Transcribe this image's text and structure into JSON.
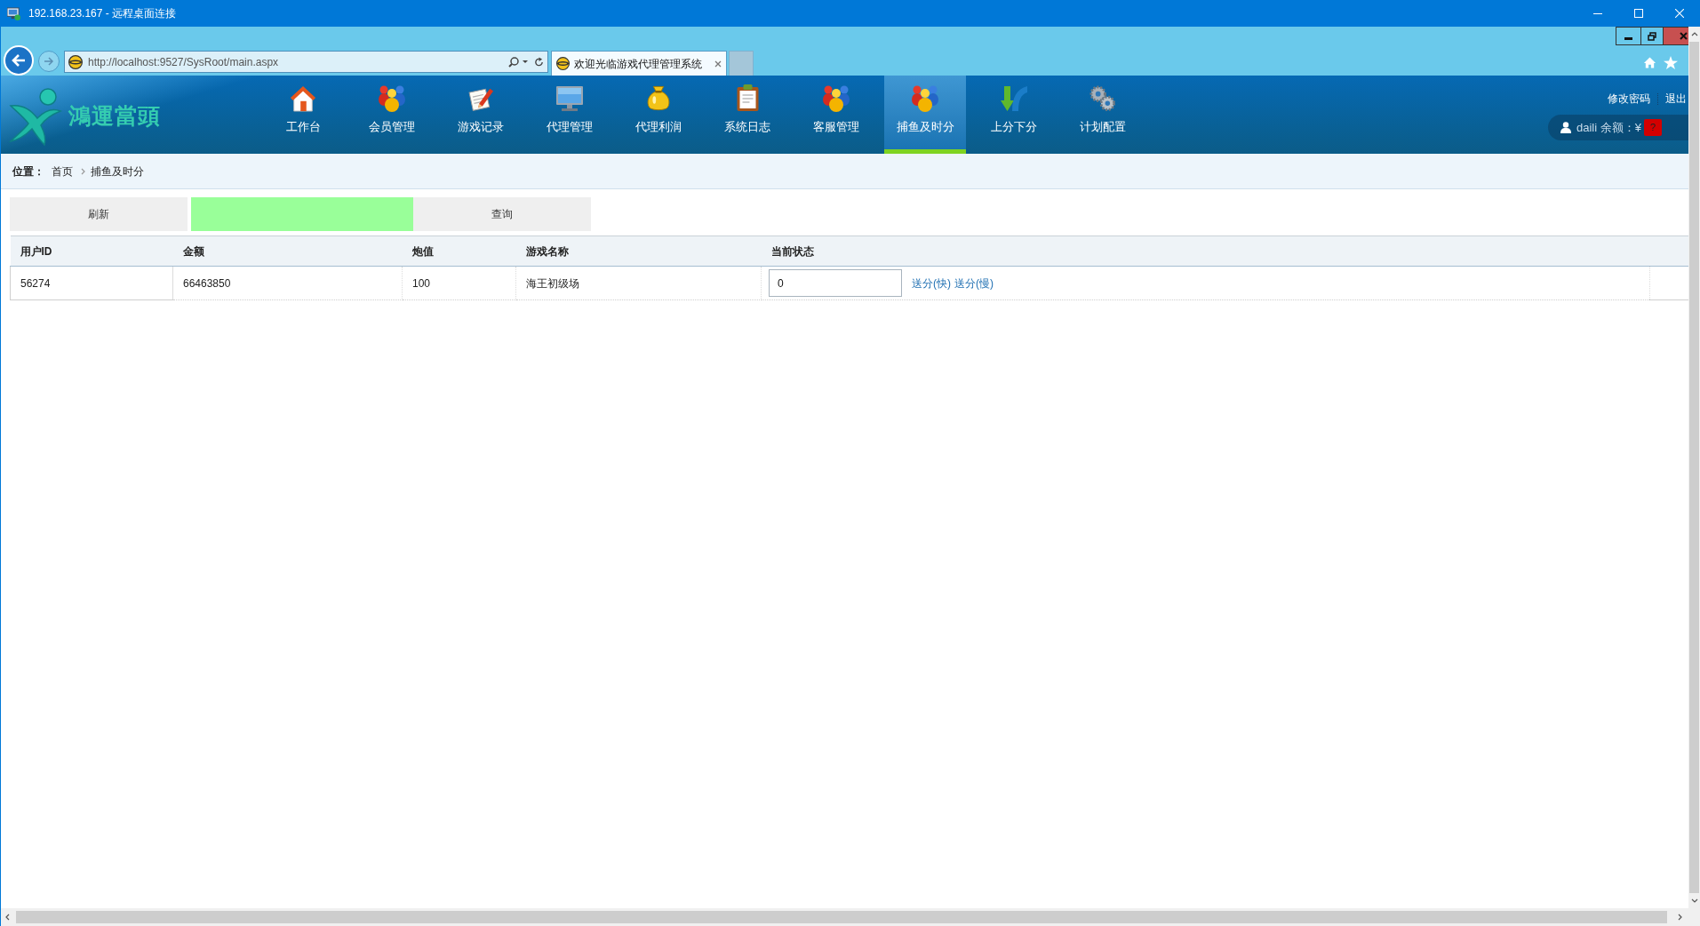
{
  "remote_window": {
    "title": "192.168.23.167 - 远程桌面连接"
  },
  "browser": {
    "address": "http://localhost:9527/SysRoot/main.aspx",
    "tabs": [
      {
        "title": "欢迎光临游戏代理管理系统",
        "selected": true
      }
    ]
  },
  "header": {
    "logo_text": "鴻運當頭",
    "nav": [
      {
        "label": "工作台",
        "kind": "house",
        "selected": false
      },
      {
        "label": "会员管理",
        "kind": "people",
        "selected": false
      },
      {
        "label": "游戏记录",
        "kind": "pencil",
        "selected": false
      },
      {
        "label": "代理管理",
        "kind": "monitor",
        "selected": false
      },
      {
        "label": "代理利润",
        "kind": "bag",
        "selected": false
      },
      {
        "label": "系统日志",
        "kind": "clipboard",
        "selected": false
      },
      {
        "label": "客服管理",
        "kind": "people",
        "selected": false
      },
      {
        "label": "捕鱼及时分",
        "kind": "people",
        "selected": true
      },
      {
        "label": "上分下分",
        "kind": "arrows",
        "selected": false
      },
      {
        "label": "计划配置",
        "kind": "gears",
        "selected": false
      }
    ],
    "user_links": [
      "修改密码",
      "退出"
    ],
    "account": {
      "text": "daili 余额：¥",
      "badge": "?"
    }
  },
  "breadcrumb": {
    "label": "位置：",
    "items": [
      "首页",
      "捕鱼及时分"
    ]
  },
  "toolbar": [
    {
      "kind": "button",
      "label": "刷新"
    },
    {
      "kind": "field"
    },
    {
      "kind": "button",
      "label": "查询"
    }
  ],
  "table": {
    "columns": [
      "用户ID",
      "金额",
      "炮值",
      "游戏名称",
      "当前状态"
    ],
    "rows": [
      {
        "cells": [
          "56274",
          "66463850",
          "100",
          "海王初级场"
        ],
        "status": "0",
        "actions": [
          "送分(快)",
          "送分(慢)"
        ]
      }
    ]
  }
}
